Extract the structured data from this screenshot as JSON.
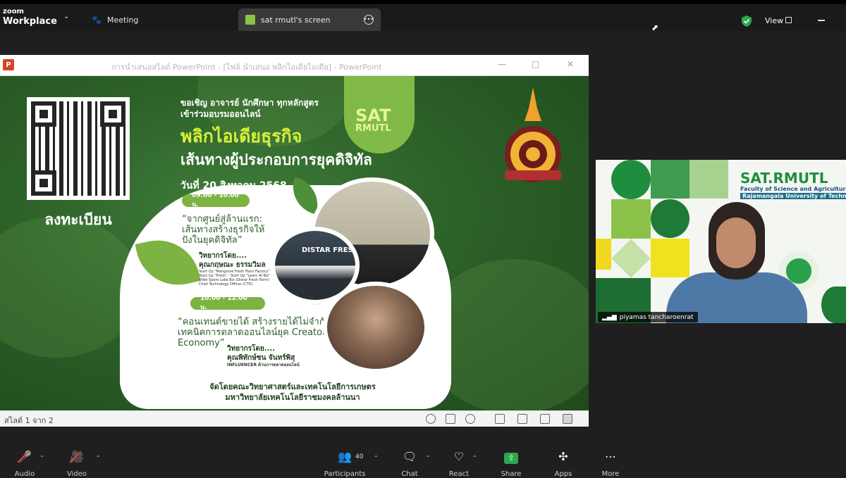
{
  "app": {
    "brand_top": "zoom",
    "brand_name": "Workplace"
  },
  "tabs": [
    {
      "label": "Meeting",
      "icon": "paw-icon"
    },
    {
      "label": "sat rmutl's screen",
      "icon": "screen-share-icon"
    }
  ],
  "header": {
    "view_label": "View"
  },
  "ppt": {
    "window_title": "การนำเสนอสไลด์ PowerPoint - [ไฟล์ นำเสนอ พลิกไอเดียไอเดีย] - PowerPoint",
    "logo": "P",
    "status_slide": "สไลด์ 1 จาก 2"
  },
  "slide": {
    "register": "ลงทะเบียน",
    "invite_line1": "ขอเชิญ อาจารย์ นักศึกษา ทุกหลักสูตร",
    "invite_line2": "เข้าร่วมอบรมออนไลน์",
    "headline1": "พลิกไอเดียธุรกิจ",
    "headline2": "เส้นทางผู้ประกอบการยุคดิจิทัล",
    "date": "วันที่ 20 สิงหาคม 2568",
    "sat_logo_1": "SAT",
    "sat_logo_2": "RMUTL",
    "session1_time": "09.00 - 10.00 น.",
    "session1_quote_1": "“จากศูนย์สู่ล้านแรก:",
    "session1_quote_2": "เส้นทางสร้างธุรกิจให้",
    "session1_quote_3": "ปังในยุคดิจิทัล”",
    "session1_speaker_label": "วิทยากรโดย....",
    "session1_speaker_name": "คุณกฤษณะ ธรรมวิมล",
    "session1_roles": "Start Up \"Mangrove Fresh Plant Factory\" · Start Up \"Fresh\" · Start Up \"Learn AI Biz\" · บริษัท Sparo Lake Biz (Distar Fresh Farm) Chief Technology Officer (CTO)",
    "session2_time": "10.00 - 12.00 น.",
    "session2_quote_1": "“คอนเทนต์ขายได้ สร้างรายได้ไม่จำกัด:",
    "session2_quote_2": "เทคนิคการตลาดออนไลน์ยุค Creator",
    "session2_quote_3": "Economy”",
    "session2_speaker_label": "วิทยากรโดย....",
    "session2_speaker_name": "คุณพิทักษ์ชน จันทร์พิสุ",
    "session2_role": "INFLUENCER ด้านการตลาดออนไลน์",
    "photo_sign": "DISTAR FRES",
    "organizer_1": "จัดโดยคณะวิทยาศาสตร์และเทคโนโลยีการเกษตร",
    "organizer_2": "มหาวิทยาลัยเทคโนโลยีราชมงคลล้านนา"
  },
  "webcam": {
    "participant_name": "piyamas tancharoenrat",
    "bg_brand": "SAT.RMUTL",
    "bg_sub1": "Faculty of Science and Agricultural Techn",
    "bg_sub2": "Rajamangala University of Technology La"
  },
  "toolbar": {
    "audio": "Audio",
    "video": "Video",
    "participants": "Participants",
    "participants_count": "40",
    "chat": "Chat",
    "react": "React",
    "share": "Share",
    "apps": "Apps",
    "more": "More"
  },
  "colors": {
    "zoom_share_green": "#2ea84f",
    "slide_green": "#2c6128",
    "accent_lime": "#d7ef3a",
    "muted_red": "#e0403a"
  }
}
